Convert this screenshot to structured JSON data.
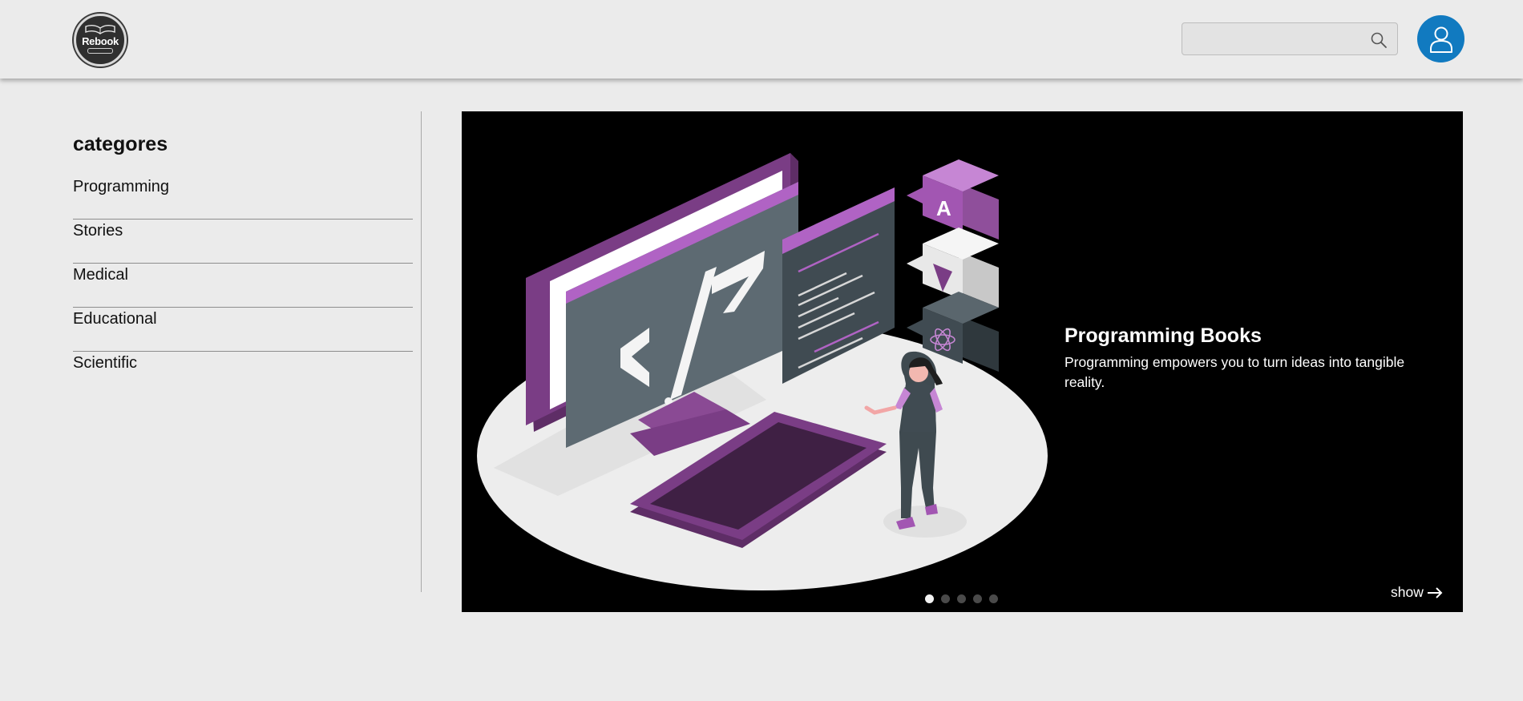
{
  "header": {
    "logo_text": "Rebook",
    "search_placeholder": "",
    "icons": {
      "search": "search-icon",
      "user": "user-icon"
    }
  },
  "sidebar": {
    "title": "categores",
    "items": [
      {
        "label": "Programming"
      },
      {
        "label": "Stories"
      },
      {
        "label": "Medical"
      },
      {
        "label": "Educational"
      },
      {
        "label": "Scientific"
      }
    ]
  },
  "slider": {
    "title": "Programming Books",
    "description": "Programming empowers you to turn ideas into tangible reality.",
    "show_label": "show",
    "dots": [
      true,
      false,
      false,
      false,
      false
    ],
    "colors": {
      "accent": "#a256b2",
      "background": "#000000"
    }
  },
  "colors": {
    "page_bg": "#ebebeb",
    "avatar_bg": "#117ac0"
  }
}
